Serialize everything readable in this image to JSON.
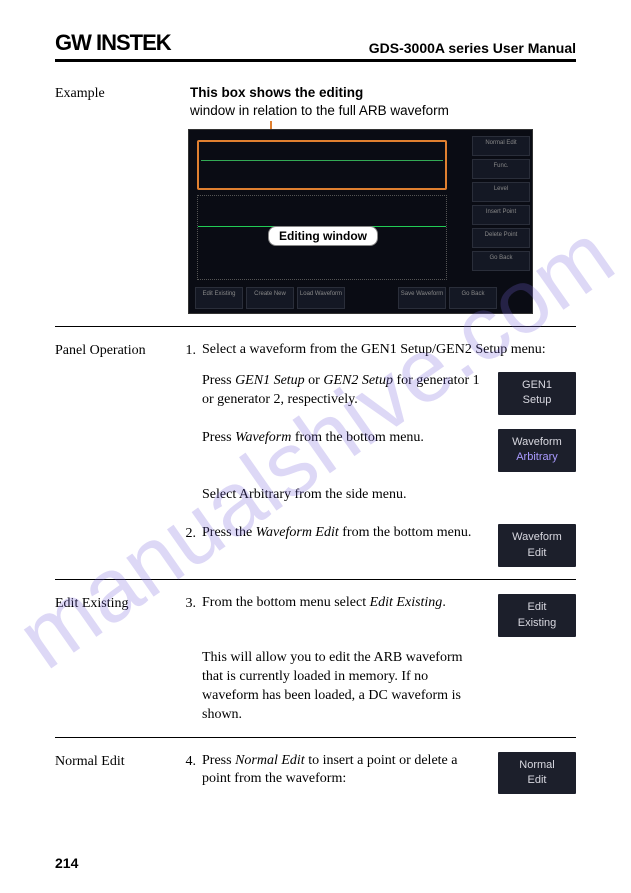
{
  "header": {
    "logo": "GW INSTEK",
    "title": "GDS-3000A series User Manual"
  },
  "watermark": "manualshive.com",
  "example": {
    "label": "Example",
    "caption_bold": "This box shows the editing",
    "caption_rest": "window in relation to the full ARB waveform",
    "editing_badge": "Editing window",
    "side_buttons": [
      "Normal Edit",
      "Func.",
      "Level",
      "Insert Point",
      "Delete Point",
      "Go Back"
    ],
    "bottom_buttons": [
      "Edit Existing",
      "Create New",
      "Load Waveform",
      "Save Waveform",
      "Go Back"
    ]
  },
  "panel_operation": {
    "label": "Panel Operation",
    "step1": {
      "num": "1.",
      "intro": "Select a waveform from the GEN1 Setup/GEN2 Setup menu:",
      "press_a_pre": "Press ",
      "press_a_i1": "GEN1 Setup",
      "press_a_mid": " or ",
      "press_a_i2": "GEN2 Setup",
      "press_a_post": " for generator 1 or generator 2, respectively.",
      "btn_a_l1": "GEN1",
      "btn_a_l2": "Setup",
      "press_b_pre": "Press ",
      "press_b_i": "Waveform",
      "press_b_post": " from the bottom menu.",
      "btn_b_l1": "Waveform",
      "btn_b_l2": "Arbitrary",
      "select_arb": "Select Arbitrary from the side menu."
    },
    "step2": {
      "num": "2.",
      "pre": "Press the ",
      "i": "Waveform Edit",
      "post": " from the bottom menu.",
      "btn_l1": "Waveform",
      "btn_l2": "Edit"
    }
  },
  "edit_existing": {
    "label": "Edit Existing",
    "num": "3.",
    "pre": "From the bottom menu select ",
    "i": "Edit Existing",
    "post": ".",
    "btn_l1": "Edit",
    "btn_l2": "Existing",
    "desc": "This will allow you to edit the ARB waveform that is currently loaded in memory. If no waveform has been loaded, a DC waveform is shown."
  },
  "normal_edit": {
    "label": "Normal Edit",
    "num": "4.",
    "pre": "Press ",
    "i": "Normal Edit",
    "post": " to insert a point or delete a point from the waveform:",
    "btn_l1": "Normal",
    "btn_l2": "Edit"
  },
  "page_number": "214"
}
